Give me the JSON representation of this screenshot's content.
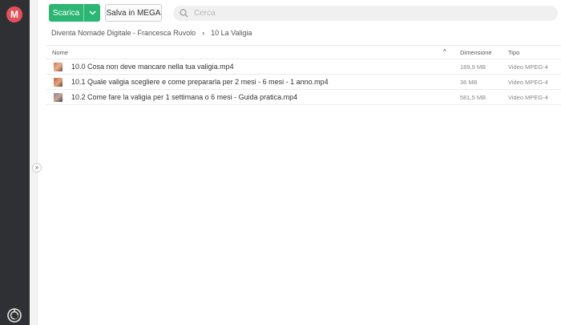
{
  "toolbar": {
    "download_label": "Scarica",
    "save_label": "Salva in MEGA"
  },
  "search": {
    "placeholder": "Cerca"
  },
  "breadcrumb": {
    "parent": "Diventa Nomade Digitale - Francesca Ruvolo",
    "current": "10 La Valigia"
  },
  "table": {
    "col_name": "Nome",
    "col_size": "Dimensione",
    "col_type": "Tipo",
    "rows": [
      {
        "name": "10.0 Cosa non deve mancare nella tua valigia.mp4",
        "size": "189,9 MB",
        "type": "Video MPEG-4"
      },
      {
        "name": "10.1 Quale valigia scegliere e come prepararla per 2 mesi - 6 mesi - 1 anno.mp4",
        "size": "36 MB",
        "type": "Video MPEG-4"
      },
      {
        "name": "10.2 Come fare la valigia per 1 settimana o 6 mesi - Guida pratica.mp4",
        "size": "581,5 MB",
        "type": "Video MPEG-4"
      }
    ]
  },
  "colors": {
    "accent_green": "#2bb673",
    "brand_red": "#e4505a",
    "rail_dark": "#2f3033"
  },
  "icons": [
    "mega-logo-icon",
    "chevron-down-icon",
    "search-icon",
    "breadcrumb-chevron-icon",
    "sort-up-icon",
    "expand-icon",
    "transfer-icon"
  ]
}
